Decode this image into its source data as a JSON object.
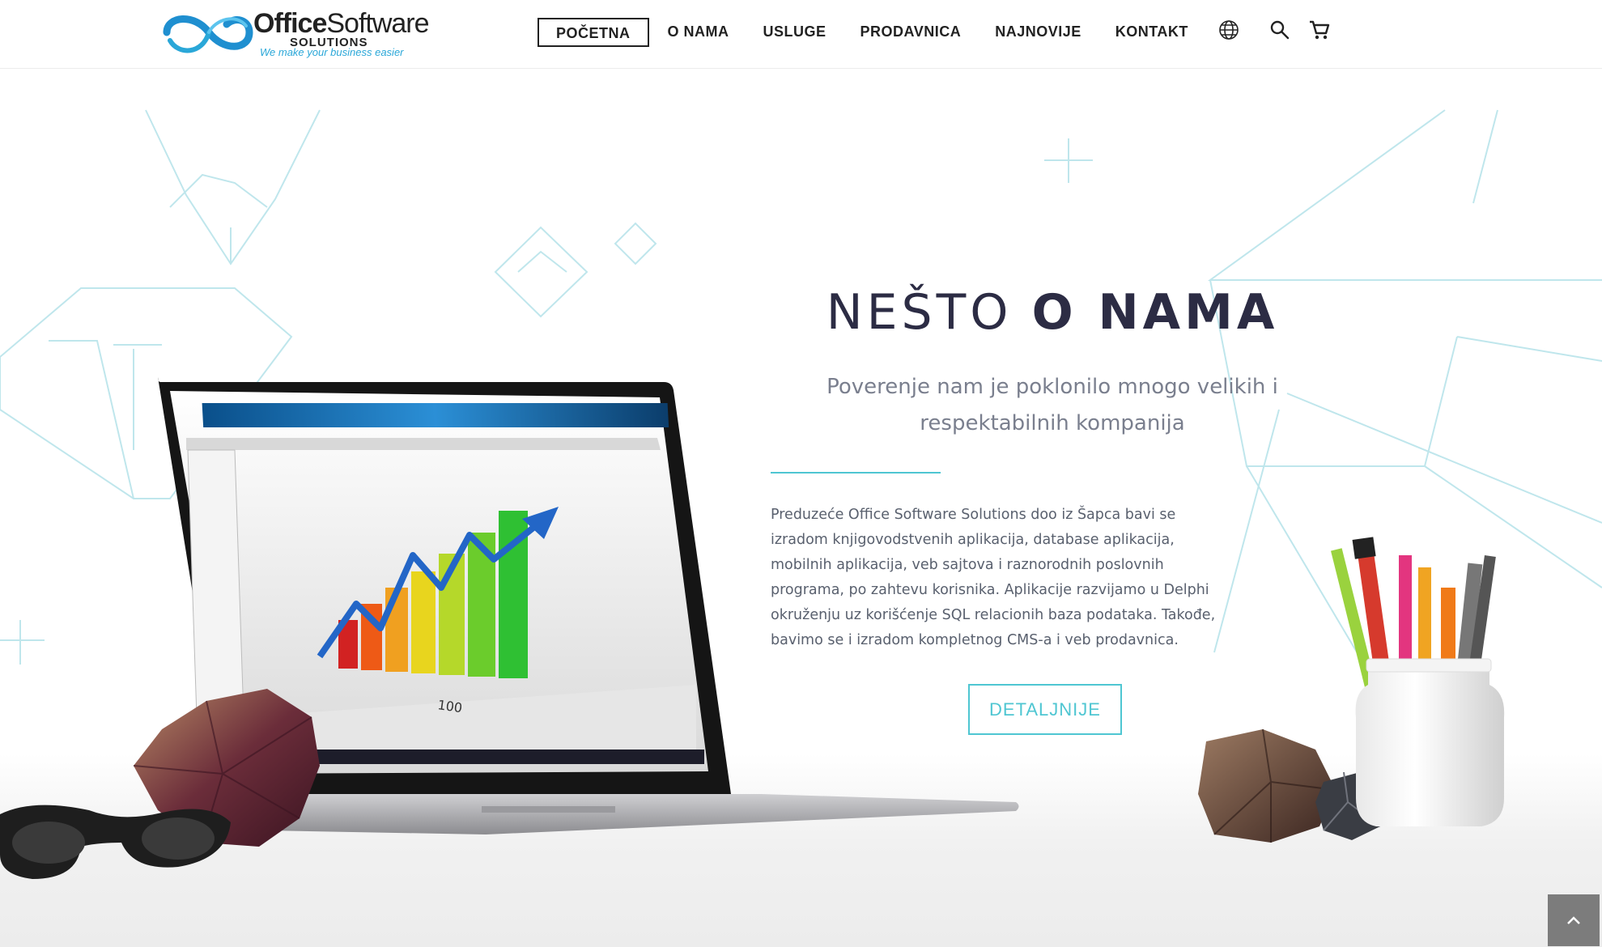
{
  "brand": {
    "name_part1": "Office",
    "name_part2": "Software",
    "line2": "SOLUTIONS",
    "tagline": "We make your business easier"
  },
  "nav": {
    "items": [
      {
        "label": "POČETNA",
        "active": true
      },
      {
        "label": "O NAMA",
        "active": false
      },
      {
        "label": "USLUGE",
        "active": false
      },
      {
        "label": "PRODAVNICA",
        "active": false
      },
      {
        "label": "NAJNOVIJE",
        "active": false
      },
      {
        "label": "KONTAKT",
        "active": false
      }
    ],
    "icons": [
      "globe-icon",
      "search-icon",
      "cart-icon"
    ]
  },
  "hero": {
    "title_light": "NEŠTO ",
    "title_bold": "O NAMA",
    "subtitle": "Poverenje nam je poklonilo mnogo velikih i respektabilnih kompanija",
    "body": "Preduzeće Office Software Solutions doo iz Šapca bavi se izradom knjigovodstvenih aplikacija, database aplikacija, mobilnih aplikacija, veb sajtova i raznorodnih poslovnih programa, po zahtevu korisnika. Aplikacije razvijamo u Delphi okruženju uz korišćenje SQL relacionih baza podataka. Takođe, bavimo se i izradom kompletnog CMS-a i veb prodavnica.",
    "button_label": "DETALJNIJE"
  },
  "colors": {
    "accent": "#4fc6d2",
    "dark": "#2c2c44",
    "logo_blue": "#2aa7d8"
  },
  "scroll_top_icon": "chevron-up-icon"
}
